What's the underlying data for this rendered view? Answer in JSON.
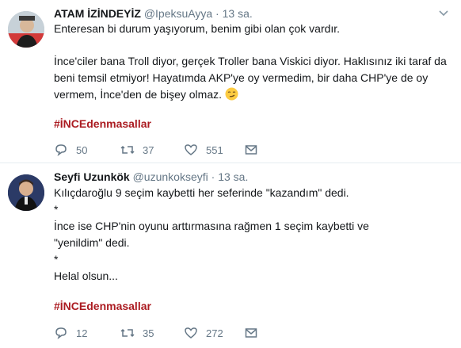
{
  "tweets": [
    {
      "name": "ATAM İZİNDEYİZ",
      "handle": "@IpeksuAyya",
      "separator": "·",
      "time": "13 sa.",
      "lines": [
        "Enteresan bi durum yaşıyorum, benim gibi olan çok vardır.",
        "İnce'ciler bana Troll diyor, gerçek Troller bana Viskici diyor. Haklısınız iki taraf da beni temsil etmiyor! Hayatımda AKP'ye oy vermedim, bir daha CHP'ye de oy vermem, İnce'den de bişey olmaz."
      ],
      "hashtag": "#İNCEdenmasallar",
      "replies": "50",
      "retweets": "37",
      "likes": "551"
    },
    {
      "name": "Seyfi Uzunkök",
      "handle": "@uzunkokseyfi",
      "separator": "·",
      "time": "13 sa.",
      "lines": [
        "Kılıçdaroğlu 9 seçim kaybetti her seferinde \"kazandım\" dedi.",
        "*",
        "İnce ise CHP'nin oyunu arttırmasına rağmen 1 seçim kaybetti ve",
        "\"yenildim\" dedi.",
        "*",
        "Helal olsun..."
      ],
      "hashtag": "#İNCEdenmasallar",
      "replies": "12",
      "retweets": "35",
      "likes": "272"
    }
  ],
  "colors": {
    "hashtag": "#ab1b21",
    "meta": "#657786",
    "divider": "#e6ecf0"
  },
  "icons": {
    "reply": "reply-icon",
    "retweet": "retweet-icon",
    "like": "heart-icon",
    "dm": "mail-icon",
    "menu": "chevron-down-icon",
    "emoji": "smirk-emoji"
  }
}
